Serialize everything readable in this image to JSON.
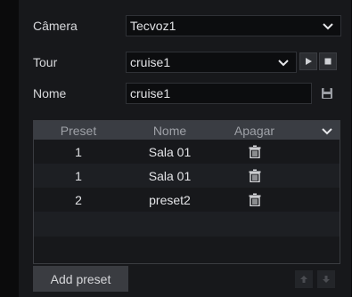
{
  "form": {
    "camera_label": "Câmera",
    "camera_value": "Tecvoz1",
    "tour_label": "Tour",
    "tour_value": "cruise1",
    "name_label": "Nome",
    "name_value": "cruise1"
  },
  "table": {
    "headers": [
      "Preset",
      "Nome",
      "Apagar"
    ],
    "rows": [
      {
        "preset": "1",
        "name": "Sala 01"
      },
      {
        "preset": "1",
        "name": "Sala 01"
      },
      {
        "preset": "2",
        "name": "preset2"
      }
    ]
  },
  "buttons": {
    "add_preset": "Add preset"
  },
  "icons": {
    "play": "play-icon",
    "stop": "stop-icon",
    "save": "save-icon",
    "delete": "trash-icon",
    "up": "arrow-up-icon",
    "down": "arrow-down-icon"
  }
}
